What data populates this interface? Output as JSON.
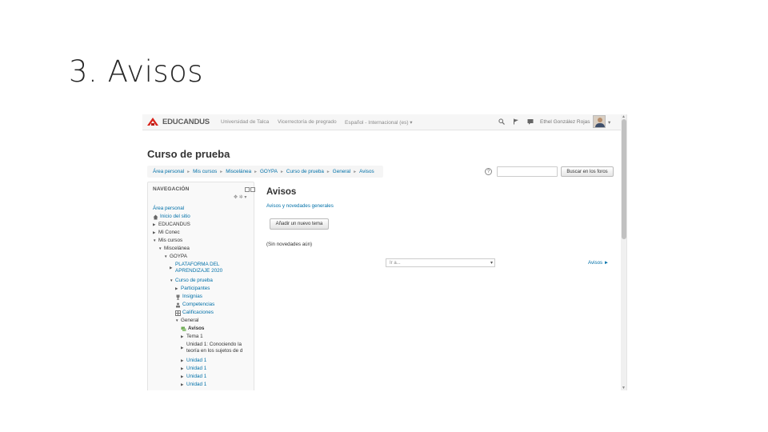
{
  "slide": {
    "title": "3. Avisos"
  },
  "navbar": {
    "brand": "EDUCANDUS",
    "links": [
      "Universidad de Talca",
      "Vicerrectoría de pregrado",
      "Español - Internacional (es) ▾"
    ],
    "user_name": "Ethel González Rojas",
    "user_caret": "▾",
    "icons": [
      "search-icon",
      "flag-icon",
      "message-icon"
    ]
  },
  "page": {
    "course_title": "Curso de prueba"
  },
  "breadcrumb": [
    "Área personal",
    "Mis cursos",
    "Miscelánea",
    "GOYPA",
    "Curso de prueba",
    "General",
    "Avisos"
  ],
  "search": {
    "help": "?",
    "placeholder": "",
    "button_label": "Buscar en los foros"
  },
  "navigation": {
    "title": "NAVEGACIÓN",
    "gear": "✥ ✲ ▾",
    "items": [
      {
        "label": "Área personal"
      },
      {
        "label": "Inicio del sitio"
      },
      {
        "label": "EDUCANDUS"
      },
      {
        "label": "Mi Conec"
      },
      {
        "label": "Mis cursos"
      },
      {
        "label": "Miscelánea"
      },
      {
        "label": "GOYPA"
      },
      {
        "label": "PLATAFORMA DEL",
        "label2": "APRENDIZAJE 2020"
      },
      {
        "label": "Curso de prueba"
      },
      {
        "label": "Participantes"
      },
      {
        "label": "Insignias"
      },
      {
        "label": "Competencias"
      },
      {
        "label": "Calificaciones"
      },
      {
        "label": "General"
      },
      {
        "label": "Avisos"
      },
      {
        "label": "Tema 1"
      },
      {
        "label": "Unidad 1: Conociendo la",
        "label2": "teoría en los sujetos de d"
      },
      {
        "label": "Unidad 1"
      },
      {
        "label": "Unidad 1"
      },
      {
        "label": "Unidad 1"
      },
      {
        "label": "Unidad 1"
      }
    ]
  },
  "forum": {
    "title": "Avisos",
    "subtitle": "Avisos y novedades generales",
    "add_button": "Añadir un nuevo tema",
    "empty_text": "(Sin novedades aún)",
    "goto_placeholder": "Ir a...",
    "next_link": "Avisos ►"
  },
  "colors": {
    "link": "#0070a8",
    "brand_red": "#d9241b",
    "navbar_bg": "#f6f6f6"
  }
}
